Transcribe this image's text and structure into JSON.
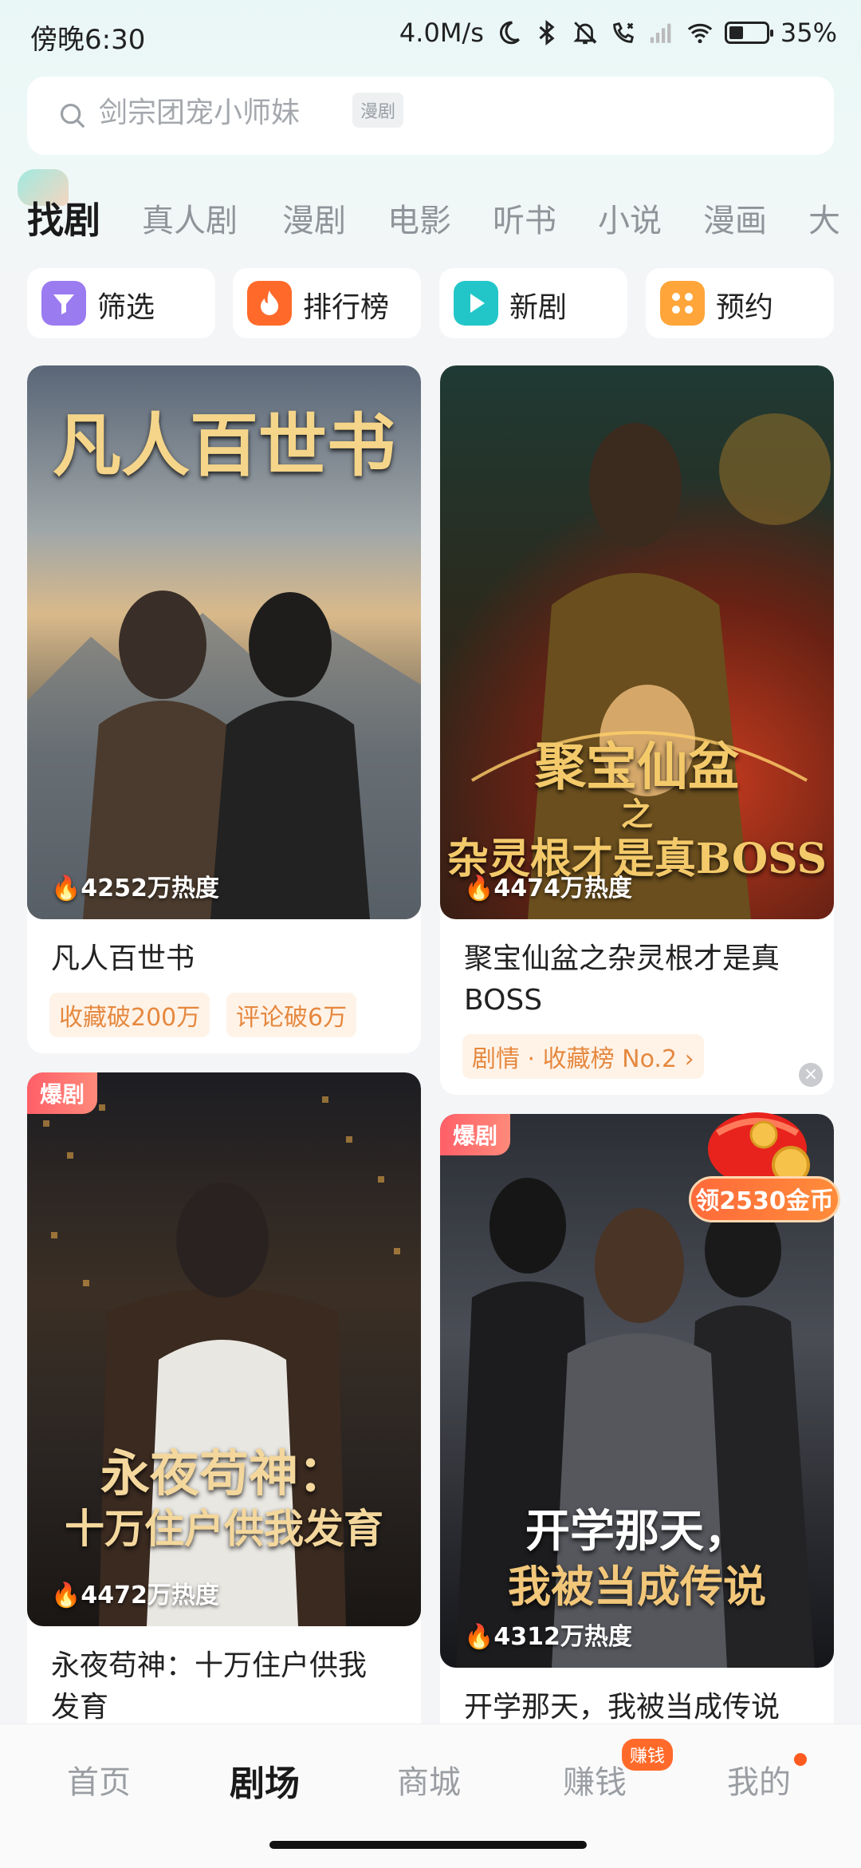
{
  "status": {
    "time": "傍晚6:30",
    "network_speed": "4.0M/s",
    "battery": "35%",
    "battery_level": 0.35
  },
  "search": {
    "placeholder": "剑宗团宠小师妹",
    "tag": "漫剧"
  },
  "tabs": [
    "找剧",
    "真人剧",
    "漫剧",
    "电影",
    "听书",
    "小说",
    "漫画",
    "大"
  ],
  "active_tab": "找剧",
  "quick_actions": [
    {
      "label": "筛选",
      "icon": "filter-icon",
      "color": "#9b7bf0"
    },
    {
      "label": "排行榜",
      "icon": "flame-icon",
      "color": "#ff6a2a"
    },
    {
      "label": "新剧",
      "icon": "play-icon",
      "color": "#23c6c8"
    },
    {
      "label": "预约",
      "icon": "grid-icon",
      "color": "#ffa53a"
    }
  ],
  "cards": [
    {
      "poster_title": "凡人百世书",
      "heat": "4252万热度",
      "title": "凡人百世书",
      "chips": [
        "收藏破200万",
        "评论破6万"
      ]
    },
    {
      "poster_title_line1": "聚宝仙盆",
      "poster_title_line2": "之",
      "poster_title_line3": "杂灵根才是真BOSS",
      "heat": "4474万热度",
      "title_line1": "聚宝仙盆之杂灵根才是真",
      "title_line2": "BOSS",
      "chip": "剧情 · 收藏榜 No.2",
      "chip_arrow": "›"
    },
    {
      "badge": "爆剧",
      "poster_title_line1": "永夜苟神：",
      "poster_title_line2": "十万住户供我发育",
      "heat": "4472万热度",
      "title_line1": "永夜苟神：十万住户供我",
      "title_line2": "发育"
    },
    {
      "badge": "爆剧",
      "poster_title_line1": "开学那天，",
      "poster_title_line2": "我被当成传说",
      "heat": "4312万热度",
      "title": "开学那天，我被当成传说"
    }
  ],
  "coin_reward": "领2530金币",
  "close_symbol": "×",
  "nav": {
    "items": [
      "首页",
      "剧场",
      "商城",
      "赚钱",
      "我的"
    ],
    "active": "剧场",
    "earn_badge": "赚钱"
  },
  "colors": {
    "accent": "#ff6a2a",
    "chip_text": "#e5883f",
    "hot_badge": "#ff5f68"
  }
}
